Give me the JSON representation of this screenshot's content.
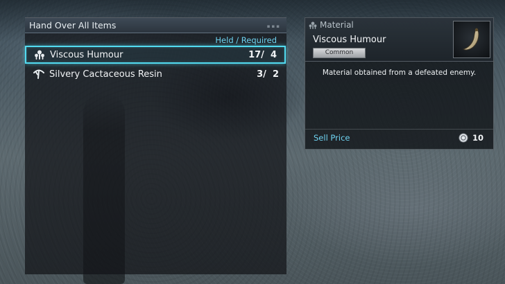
{
  "list": {
    "title": "Hand Over All Items",
    "column_header": "Held / Required",
    "items": [
      {
        "name": "Viscous Humour",
        "count": "17/  4",
        "icon": "material-cluster-icon",
        "selected": true
      },
      {
        "name": "Silvery Cactaceous Resin",
        "count": "3/  2",
        "icon": "material-leaf-icon",
        "selected": false
      }
    ]
  },
  "detail": {
    "category": "Material",
    "category_icon": "material-cluster-icon",
    "item_name": "Viscous Humour",
    "rarity": "Common",
    "thumbnail_icon": "fang-icon",
    "description": "Material obtained from a defeated enemy.",
    "sell_label": "Sell Price",
    "sell_icon": "coin-icon",
    "sell_value": "10"
  },
  "colors": {
    "accent": "#52dbf0",
    "label_blue": "#6fd4f2",
    "text": "#f2f4f6"
  }
}
